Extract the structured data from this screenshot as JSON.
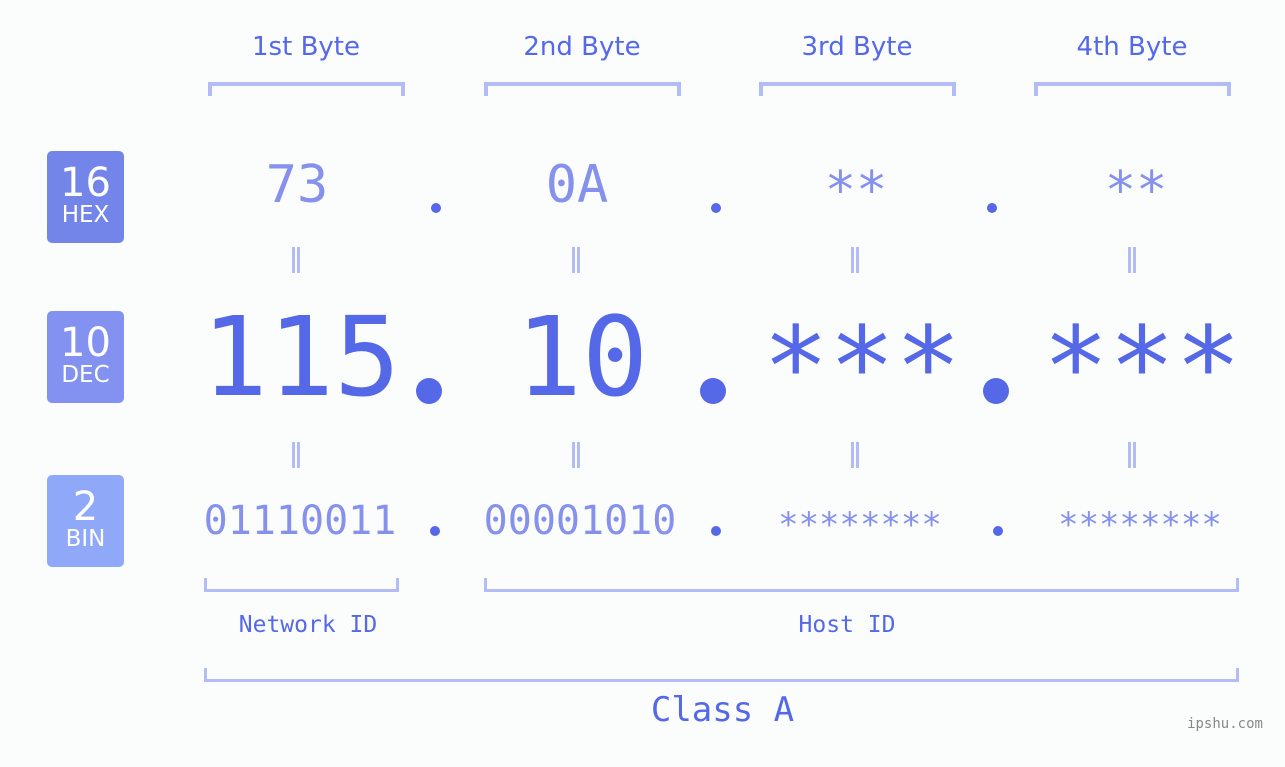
{
  "header": {
    "bytes": [
      "1st Byte",
      "2nd Byte",
      "3rd Byte",
      "4th Byte"
    ]
  },
  "badges": [
    {
      "number": "16",
      "label": "HEX",
      "color": "#7485ea"
    },
    {
      "number": "10",
      "label": "DEC",
      "color": "#8392f0"
    },
    {
      "number": "2",
      "label": "BIN",
      "color": "#8fa8f8"
    }
  ],
  "hex": {
    "octets": [
      "73",
      "0A",
      "**",
      "**"
    ]
  },
  "dec": {
    "octets": [
      "115",
      "10",
      "***",
      "***"
    ]
  },
  "bin": {
    "octets": [
      "01110011",
      "00001010",
      "********",
      "********"
    ]
  },
  "separator": ".",
  "equals_symbol": "=",
  "ids": {
    "network": "Network ID",
    "host": "Host ID"
  },
  "class_label": "Class A",
  "watermark": "ipshu.com",
  "colors": {
    "accent": "#5468e8",
    "secondary": "#8591ec",
    "bracket": "#b3bcf5",
    "background": "#fbfdfc"
  }
}
